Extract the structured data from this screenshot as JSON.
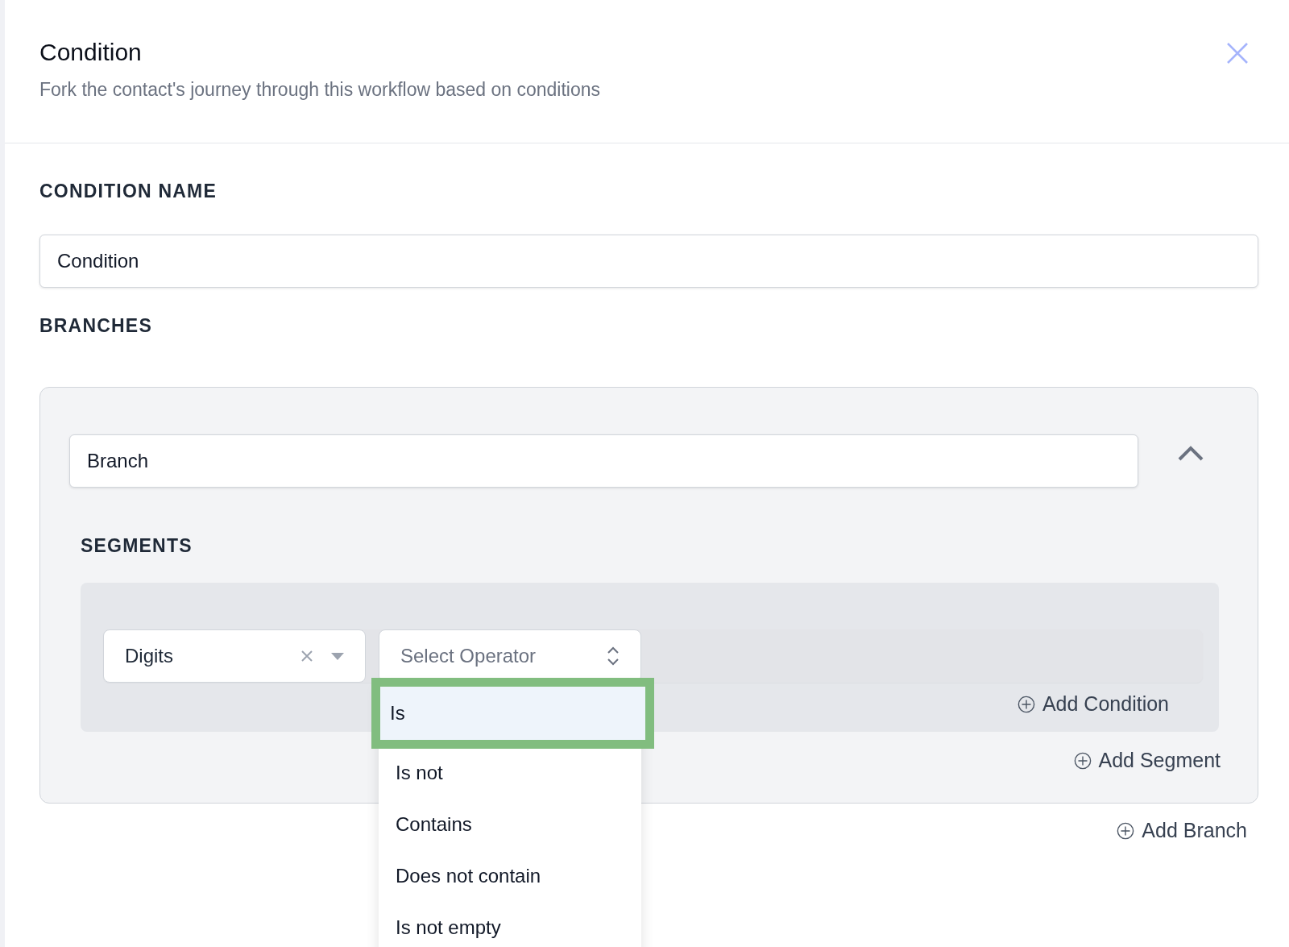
{
  "header": {
    "title": "Condition",
    "subtitle": "Fork the contact's journey through this workflow based on conditions"
  },
  "condition_name": {
    "label": "CONDITION NAME",
    "value": "Condition"
  },
  "branches": {
    "label": "BRANCHES",
    "items": [
      {
        "name": "Branch",
        "expanded": true,
        "segments_label": "SEGMENTS",
        "segments": [
          {
            "conditions": [
              {
                "field": {
                  "value": "Digits"
                },
                "operator": {
                  "placeholder": "Select Operator",
                  "open": true,
                  "options": [
                    {
                      "label": "Is",
                      "selected": true,
                      "highlighted": true
                    },
                    {
                      "label": "Is not",
                      "selected": false,
                      "highlighted": false
                    },
                    {
                      "label": "Contains",
                      "selected": false,
                      "highlighted": false
                    },
                    {
                      "label": "Does not contain",
                      "selected": false,
                      "highlighted": false
                    },
                    {
                      "label": "Is not empty",
                      "selected": false,
                      "highlighted": false
                    }
                  ]
                }
              }
            ],
            "add_condition": "Add Condition"
          }
        ],
        "add_segment": "Add Segment"
      }
    ],
    "add_branch": "Add Branch"
  }
}
